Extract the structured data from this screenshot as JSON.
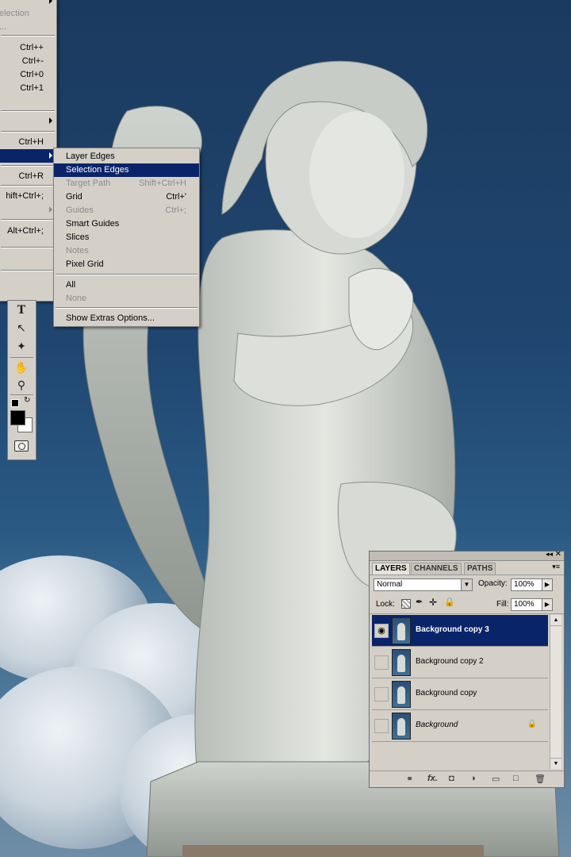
{
  "view_menu": {
    "partial_items": [
      {
        "label": "election",
        "shortcut": ""
      },
      {
        "label": "...",
        "shortcut": ""
      },
      {
        "label": "",
        "shortcut": "Ctrl++"
      },
      {
        "label": "",
        "shortcut": "Ctrl+-"
      },
      {
        "label": "",
        "shortcut": "Ctrl+0"
      },
      {
        "label": "",
        "shortcut": "Ctrl+1"
      },
      {
        "label": "",
        "shortcut": "Ctrl+H"
      },
      {
        "label": "",
        "shortcut": "Ctrl+R"
      },
      {
        "label": "",
        "shortcut": "hift+Ctrl+;"
      },
      {
        "label": "",
        "shortcut": "Alt+Ctrl+;"
      }
    ]
  },
  "extras_submenu": {
    "items": [
      {
        "label": "Layer Edges",
        "shortcut": ""
      },
      {
        "label": "Selection Edges",
        "shortcut": ""
      },
      {
        "label": "Target Path",
        "shortcut": "Shift+Ctrl+H"
      },
      {
        "label": "Grid",
        "shortcut": "Ctrl+'"
      },
      {
        "label": "Guides",
        "shortcut": "Ctrl+;"
      },
      {
        "label": "Smart Guides",
        "shortcut": ""
      },
      {
        "label": "Slices",
        "shortcut": ""
      },
      {
        "label": "Notes",
        "shortcut": ""
      },
      {
        "label": "Pixel Grid",
        "shortcut": ""
      },
      {
        "label": "All",
        "shortcut": ""
      },
      {
        "label": "None",
        "shortcut": ""
      },
      {
        "label": "Show Extras Options...",
        "shortcut": ""
      }
    ]
  },
  "tools": [
    "type-tool-icon",
    "path-selection-icon",
    "custom-shape-icon",
    "hand-tool-icon",
    "zoom-tool-icon",
    "color-swatches-icon",
    "quick-mask-icon"
  ],
  "layers_panel": {
    "tabs": [
      "LAYERS",
      "CHANNELS",
      "PATHS"
    ],
    "blend_mode": "Normal",
    "opacity_label": "Opacity:",
    "opacity_value": "100%",
    "lock_label": "Lock:",
    "fill_label": "Fill:",
    "fill_value": "100%",
    "layers": [
      {
        "name": "Background copy 3",
        "visible": true,
        "selected": true
      },
      {
        "name": "Background copy 2",
        "visible": false,
        "selected": false
      },
      {
        "name": "Background copy",
        "visible": false,
        "selected": false
      },
      {
        "name": "Background",
        "visible": false,
        "selected": false,
        "locked": true
      }
    ],
    "bottom_icons": [
      "link-layers-icon",
      "fx-icon",
      "add-mask-icon",
      "adjustment-layer-icon",
      "new-group-icon",
      "new-layer-icon",
      "delete-layer-icon"
    ],
    "fx_label": "fx."
  },
  "colors": {
    "menu_bg": "#d4d0c8",
    "highlight": "#0a246a",
    "sky": "#1f4670"
  }
}
